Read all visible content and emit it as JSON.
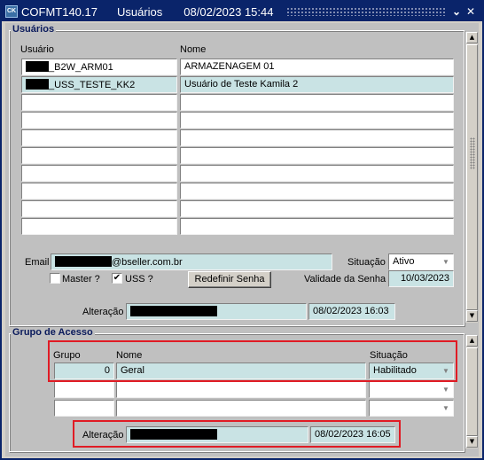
{
  "window": {
    "form_code": "COFMT140.17",
    "form_name": "Usuários",
    "datetime": "08/02/2023 15:44",
    "icon_text": "CK"
  },
  "usuarios": {
    "section_title": "Usuários",
    "col_usuario": "Usuário",
    "col_nome": "Nome",
    "rows": [
      {
        "usuario": "_B2W_ARM01",
        "nome": "ARMAZENAGEM 01"
      },
      {
        "usuario": "_USS_TESTE_KK2",
        "nome": "Usuário de Teste Kamila 2"
      },
      {
        "usuario": "",
        "nome": ""
      },
      {
        "usuario": "",
        "nome": ""
      },
      {
        "usuario": "",
        "nome": ""
      },
      {
        "usuario": "",
        "nome": ""
      },
      {
        "usuario": "",
        "nome": ""
      },
      {
        "usuario": "",
        "nome": ""
      },
      {
        "usuario": "",
        "nome": ""
      },
      {
        "usuario": "",
        "nome": ""
      }
    ],
    "email_label": "Email",
    "email_domain": "@bseller.com.br",
    "situacao_label": "Situação",
    "situacao_value": "Ativo",
    "master_label": "Master ?",
    "master_checked": false,
    "uss_label": "USS ?",
    "uss_checked": true,
    "check_mark": "✔",
    "redefinir_label": "Redefinir Senha",
    "validade_label": "Validade da Senha",
    "validade_value": "10/03/2023",
    "alteracao_label": "Alteração",
    "alteracao_date": "08/02/2023 16:03"
  },
  "grupo": {
    "section_title": "Grupo de Acesso",
    "col_grupo": "Grupo",
    "col_nome": "Nome",
    "col_situacao": "Situação",
    "rows": [
      {
        "grupo": "0",
        "nome": "Geral",
        "situacao": "Habilitado"
      },
      {
        "grupo": "",
        "nome": "",
        "situacao": ""
      },
      {
        "grupo": "",
        "nome": "",
        "situacao": ""
      }
    ],
    "alteracao_label": "Alteração",
    "alteracao_date": "08/02/2023 16:05"
  },
  "icons": {
    "dropdown": "▼",
    "scroll_up": "▲",
    "scroll_down": "▼",
    "minimize": "⌄",
    "close": "✕"
  },
  "colors": {
    "titlebar": "#0a246a",
    "highlight": "#e01b24",
    "selected_row": "#c9e3e4"
  }
}
